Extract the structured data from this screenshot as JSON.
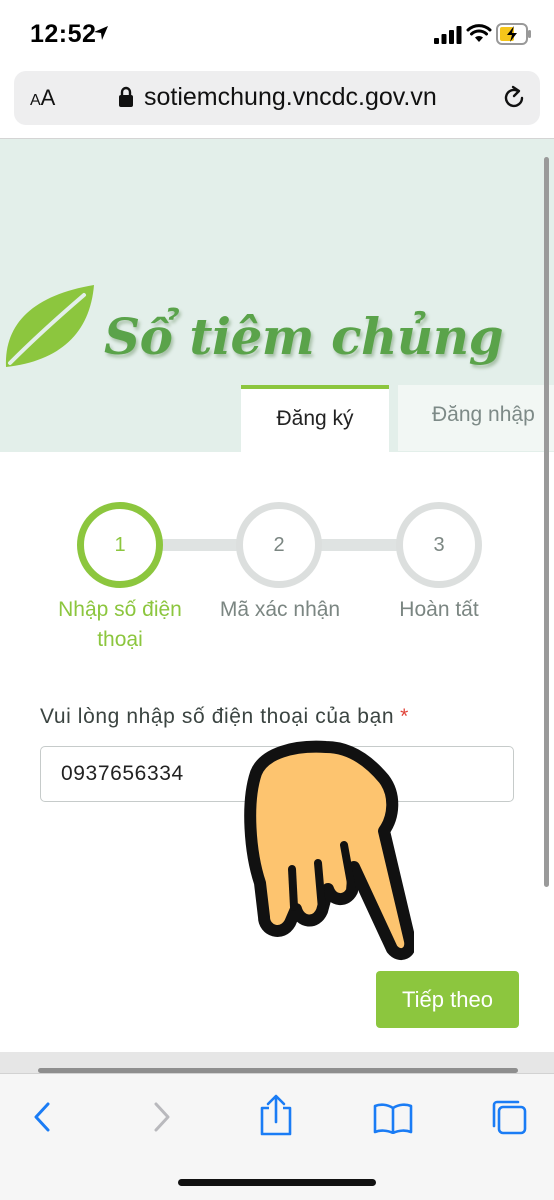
{
  "status_bar": {
    "time": "12:52"
  },
  "address_bar": {
    "text_size_label_small": "A",
    "text_size_label_large": "A",
    "url": "sotiemchung.vncdc.gov.vn"
  },
  "site": {
    "brand": "Sổ tiêm chủng",
    "tabs": {
      "register": "Đăng ký",
      "login": "Đăng nhập"
    },
    "steps": [
      {
        "number": "1",
        "label_line1": "Nhập số điện",
        "label_line2": "thoại",
        "active": true
      },
      {
        "number": "2",
        "label_line1": "Mã xác nhận",
        "label_line2": "",
        "active": false
      },
      {
        "number": "3",
        "label_line1": "Hoàn tất",
        "label_line2": "",
        "active": false
      }
    ],
    "form": {
      "phone_label": "Vui lòng nhập số điện thoại của bạn",
      "required_marker": "*",
      "phone_value": "0937656334",
      "next_button": "Tiếp theo"
    }
  },
  "colors": {
    "accent_green": "#8cc63e",
    "hero_background": "#e3efea",
    "ios_blue": "#1a7cf5"
  },
  "icons": [
    "location-arrow-icon",
    "signal-icon",
    "wifi-icon",
    "battery-charging-icon",
    "lock-icon",
    "reload-icon",
    "leaf-icon",
    "hand-pointer-icon",
    "back-icon",
    "forward-icon",
    "share-icon",
    "bookmarks-icon",
    "tabs-icon"
  ]
}
